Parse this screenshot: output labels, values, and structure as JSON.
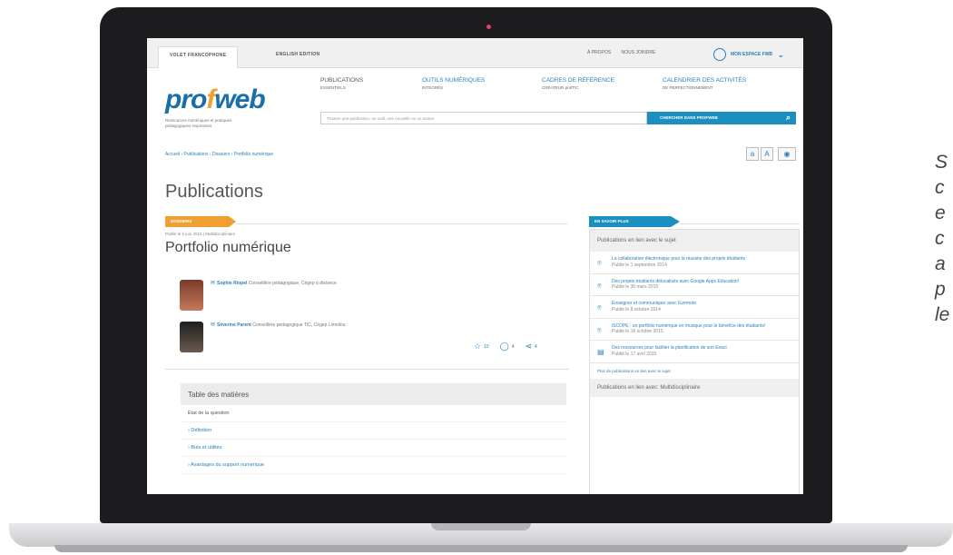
{
  "colors": {
    "brand_blue": "#1b6fa8",
    "accent_orange": "#f0a032",
    "button_blue": "#1a8fc0"
  },
  "topbar": {
    "tabs": [
      "VOLET FRANCOPHONE",
      "ENGLISH EDITION"
    ],
    "links": [
      "À PROPOS",
      "NOUS JOINDRE"
    ],
    "profile": "MON ESPACE FWB"
  },
  "header": {
    "logo_a": "pro",
    "logo_b": "f",
    "logo_c": "web",
    "tagline": "Ressources numériques et pratiques pédagogiques inspirantes",
    "nav": [
      {
        "label": "PUBLICATIONS",
        "sub": "ESSENTIELS"
      },
      {
        "label": "OUTILS NUMÉRIQUES",
        "sub": "INTÉGRÉS"
      },
      {
        "label": "CADRES DE RÉFÉRENCE",
        "sub": "CRÉATEUR  profTIC"
      },
      {
        "label": "CALENDRIER DES ACTIVITÉS",
        "sub": "DE PERFECTIONNEMENT"
      }
    ],
    "search_placeholder": "Trouver une publication, un outil, une nouvelle ou un acteur",
    "search_button": "CHERCHER DANS PROFWEB"
  },
  "breadcrumb": "Accueil › Publications › Dossiers › Portfolio numérique",
  "text_tools": {
    "small_a": "a",
    "big_a": "A",
    "eye": "◉"
  },
  "page_title": "Publications",
  "article": {
    "tag": "DOSSIERS",
    "date": "Publié le 5 juin 2015 | Multidisciplinaire",
    "title": "Portfolio numérique",
    "authors": [
      {
        "name": "Sophie Riopel",
        "role": "Conseillère pédagogique, Cégep à distance"
      },
      {
        "name": "Séverine Parent",
        "role": "Conseillère pédagogique TIC, Cégep Limoilou"
      }
    ],
    "stats": {
      "likes": "10",
      "comments": "4",
      "shares": "4"
    }
  },
  "toc": {
    "title": "Table des matières",
    "items": [
      {
        "label": "État de la question",
        "link": false
      },
      {
        "label": "› Définition",
        "link": true
      },
      {
        "label": "› Buts et utilités",
        "link": true
      },
      {
        "label": "› Avantages du support numérique",
        "link": true
      }
    ]
  },
  "sidebar": {
    "tag": "EN SAVOIR PLUS",
    "head": "Publications en lien avec le sujet",
    "items": [
      {
        "title": "La collaboration électronique pour la réussite des projets étudiants",
        "date": "Publié le 1 septembre 2014"
      },
      {
        "title": "Des projets étudiants délocalisés avec Google Apps Education!",
        "date": "Publié le 30 mars 2015"
      },
      {
        "title": "Enseigner et communiquer avec Evernote",
        "date": "Publié le 8 octobre 2014"
      },
      {
        "title": "iSCOPE : un portfolio numérique en musique pour le bénéfice des étudiants!",
        "date": "Publié le 16 octobre 2015"
      },
      {
        "title": "Des ressources pour faciliter la planification de son Exact",
        "date": "Publié le 17 avril 2015"
      }
    ],
    "more": "Plus de publications en lien avec le sujet",
    "head2": "Publications en lien avec: Multidisciplinaire"
  },
  "right_text": [
    "S",
    "c",
    "e",
    "c",
    "a",
    "p",
    "le"
  ]
}
